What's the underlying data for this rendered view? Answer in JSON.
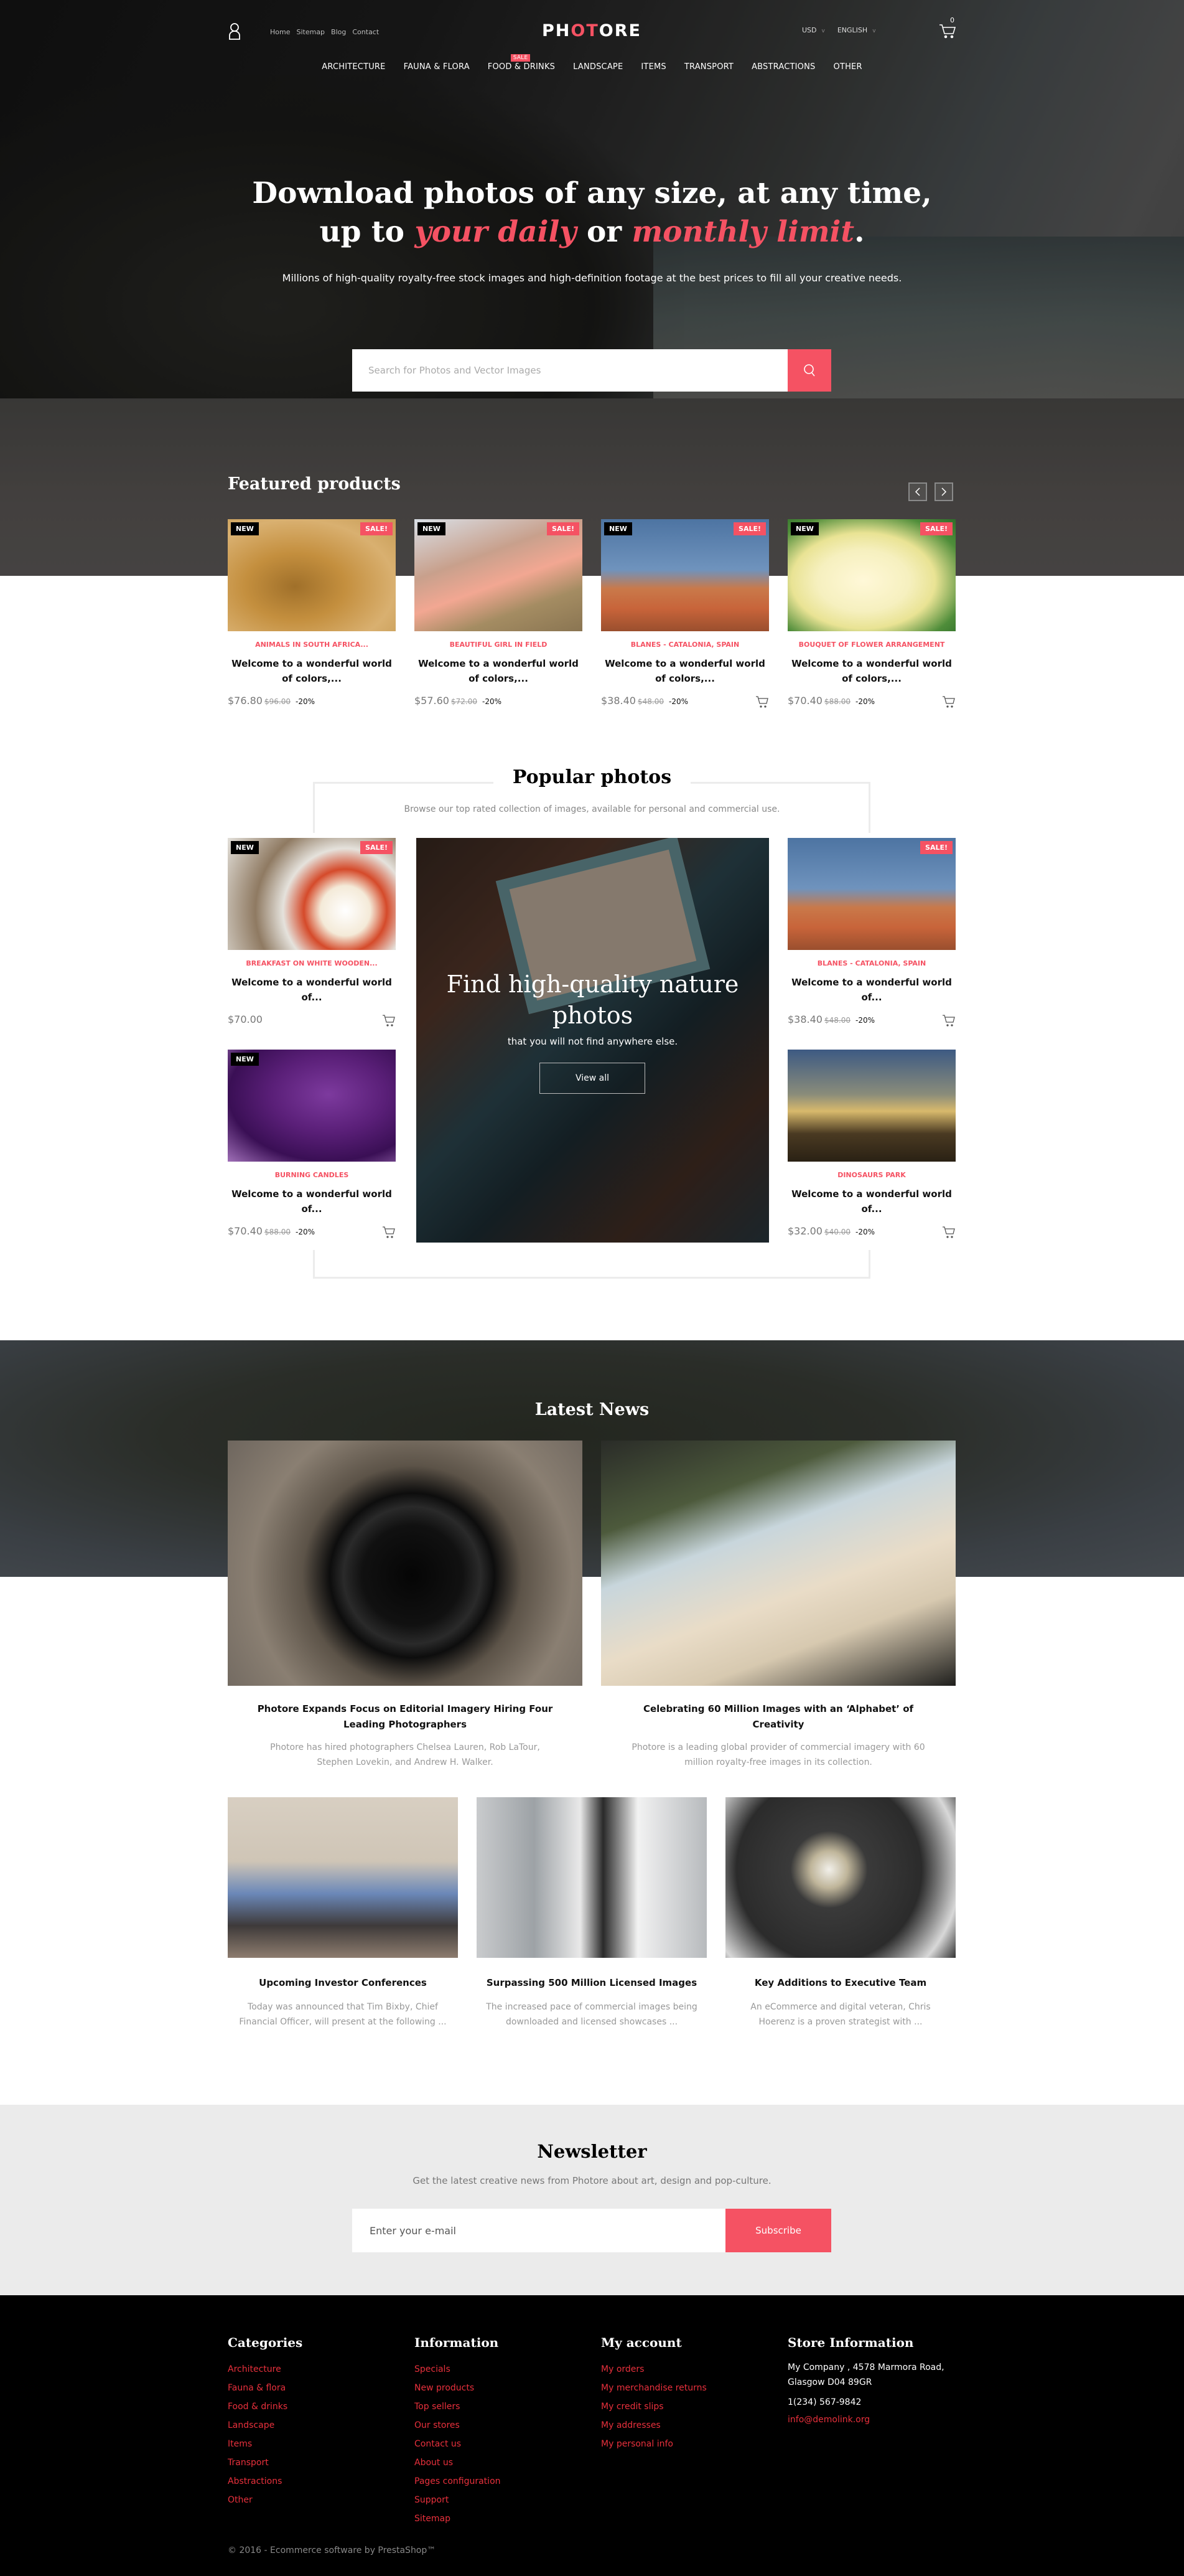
{
  "brand": {
    "logo_pre": "PH",
    "logo_accent": "OT",
    "logo_post": "ORE",
    "accent_color": "#f55263"
  },
  "header": {
    "top_links": [
      "Home",
      "Sitemap",
      "Blog",
      "Contact"
    ],
    "currency": "USD",
    "language": "ENGLISH",
    "cart_count": "0"
  },
  "nav": {
    "items": [
      "ARCHITECTURE",
      "FAUNA & FLORA",
      "FOOD & DRINKS",
      "LANDSCAPE",
      "ITEMS",
      "TRANSPORT",
      "ABSTRACTIONS",
      "OTHER"
    ],
    "sale_tag": "SALE"
  },
  "hero": {
    "line1": "Download photos of any size, at any time,",
    "line2_pre": "up to ",
    "line2_hl1": "your daily",
    "line2_mid": " or ",
    "line2_hl2": "monthly limit",
    "line2_post": ".",
    "subtitle": "Millions of high-quality royalty-free stock images and high-definition footage at the best prices to fill all your creative needs.",
    "search_placeholder": "Search for Photos and Vector Images"
  },
  "featured": {
    "title": "Featured products",
    "products": [
      {
        "category": "ANIMALS IN SOUTH AFRICA...",
        "name": "Welcome to a wonderful world of colors,...",
        "price": "$76.80",
        "old_price": "$96.00",
        "discount": "-20%",
        "badge_new": "NEW",
        "badge_sale": "SALE!"
      },
      {
        "category": "BEAUTIFUL GIRL IN FIELD",
        "name": "Welcome to a wonderful world of colors,...",
        "price": "$57.60",
        "old_price": "$72.00",
        "discount": "-20%",
        "badge_new": "NEW",
        "badge_sale": "SALE!"
      },
      {
        "category": "BLANES - CATALONIA, SPAIN",
        "name": "Welcome to a wonderful world of colors,...",
        "price": "$38.40",
        "old_price": "$48.00",
        "discount": "-20%",
        "badge_new": "NEW",
        "badge_sale": "SALE!"
      },
      {
        "category": "BOUQUET OF FLOWER ARRANGEMENT",
        "name": "Welcome to a wonderful world of colors,...",
        "price": "$70.40",
        "old_price": "$88.00",
        "discount": "-20%",
        "badge_new": "NEW",
        "badge_sale": "SALE!"
      }
    ]
  },
  "popular": {
    "title": "Popular photos",
    "subtitle": "Browse our top rated collection of images, available for personal and commercial use.",
    "products": [
      {
        "category": "BREAKFAST ON WHITE WOODEN...",
        "name": "Welcome to a wonderful world of...",
        "price": "$70.00",
        "old_price": "",
        "discount": "",
        "badge_new": "NEW",
        "badge_sale": "SALE!"
      },
      {
        "category": "BURNING CANDLES",
        "name": "Welcome to a wonderful world of...",
        "price": "$70.40",
        "old_price": "$88.00",
        "discount": "-20%",
        "badge_new": "NEW",
        "badge_sale": ""
      },
      {
        "category": "BLANES - CATALONIA, SPAIN",
        "name": "Welcome to a wonderful world of...",
        "price": "$38.40",
        "old_price": "$48.00",
        "discount": "-20%",
        "badge_new": "",
        "badge_sale": "SALE!"
      },
      {
        "category": "DINOSAURS PARK",
        "name": "Welcome to a wonderful world of...",
        "price": "$32.00",
        "old_price": "$40.00",
        "discount": "-20%",
        "badge_new": "",
        "badge_sale": ""
      }
    ],
    "promo": {
      "heading": "Find high-quality nature photos",
      "sub": "that you will not find anywhere else.",
      "button": "View all"
    }
  },
  "news": {
    "title": "Latest News",
    "items": [
      {
        "title": "Photore Expands Focus on Editorial Imagery Hiring Four Leading Photographers",
        "excerpt": "Photore has hired photographers Chelsea Lauren, Rob LaTour, Stephen Lovekin, and Andrew H. Walker."
      },
      {
        "title": "Celebrating 60 Million Images with an ‘Alphabet’ of Creativity",
        "excerpt": "Photore is a leading global provider of commercial imagery with 60 million royalty-free images in its collection."
      },
      {
        "title": "Upcoming Investor Conferences",
        "excerpt": "Today was announced that Tim Bixby, Chief Financial Officer, will present at the following ..."
      },
      {
        "title": "Surpassing 500 Million Licensed Images",
        "excerpt": "The increased pace of commercial images being downloaded and licensed showcases ..."
      },
      {
        "title": "Key Additions to Executive Team",
        "excerpt": "An eCommerce and digital veteran, Chris Hoerenz is a proven strategist with ..."
      }
    ]
  },
  "newsletter": {
    "title": "Newsletter",
    "subtitle": "Get the latest creative news from Photore about art, design and pop-culture.",
    "placeholder": "Enter your e-mail",
    "button": "Subscribe"
  },
  "footer": {
    "categories": {
      "title": "Categories",
      "links": [
        "Architecture",
        "Fauna & flora",
        "Food & drinks",
        "Landscape",
        "Items",
        "Transport",
        "Abstractions",
        "Other"
      ]
    },
    "information": {
      "title": "Information",
      "links": [
        "Specials",
        "New products",
        "Top sellers",
        "Our stores",
        "Contact us",
        "About us",
        "Pages configuration",
        "Support",
        "Sitemap"
      ]
    },
    "account": {
      "title": "My account",
      "links": [
        "My orders",
        "My merchandise returns",
        "My credit slips",
        "My addresses",
        "My personal info"
      ]
    },
    "store": {
      "title": "Store Information",
      "address": "My Company , 4578 Marmora Road, Glasgow D04 89GR",
      "phone": "1(234) 567-9842",
      "email": "info@demolink.org"
    },
    "copyright": "© 2016 - Ecommerce software by PrestaShop™"
  }
}
